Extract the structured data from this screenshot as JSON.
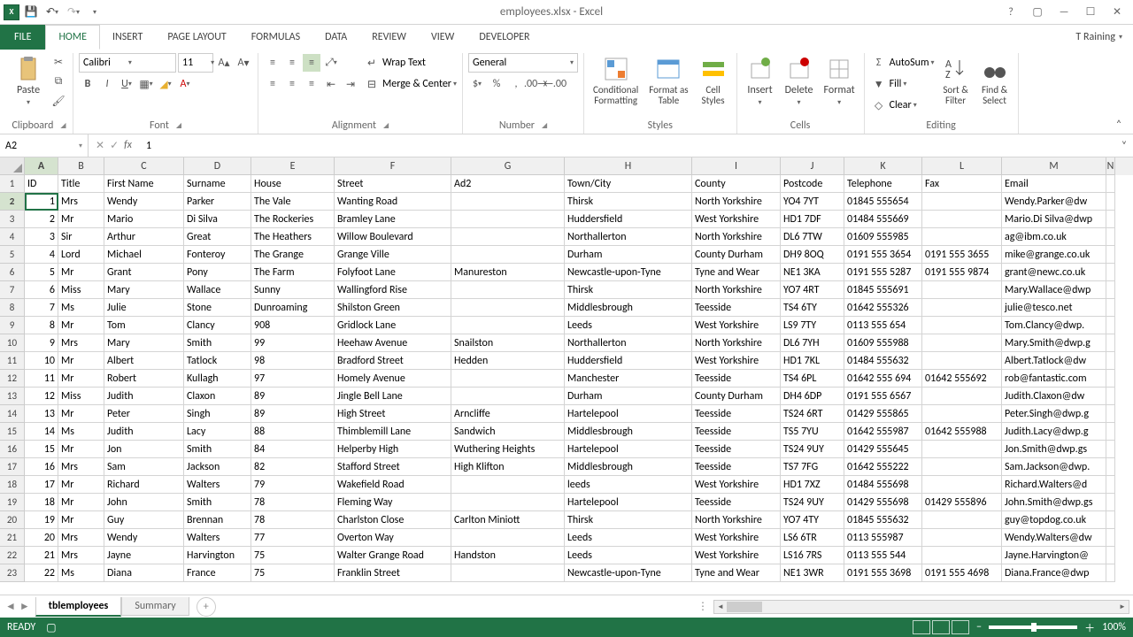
{
  "title": "employees.xlsx - Excel",
  "user": "T Raining",
  "tabs": {
    "file": "FILE",
    "home": "HOME",
    "insert": "INSERT",
    "page": "PAGE LAYOUT",
    "formulas": "FORMULAS",
    "data": "DATA",
    "review": "REVIEW",
    "view": "VIEW",
    "dev": "DEVELOPER"
  },
  "ribbon": {
    "clipboard": {
      "paste": "Paste",
      "label": "Clipboard"
    },
    "font": {
      "name": "Calibri",
      "size": "11",
      "label": "Font"
    },
    "alignment": {
      "wrap": "Wrap Text",
      "merge": "Merge & Center",
      "label": "Alignment"
    },
    "number": {
      "format": "General",
      "label": "Number"
    },
    "styles": {
      "cond": "Conditional\nFormatting",
      "fmt": "Format as\nTable",
      "cell": "Cell\nStyles",
      "label": "Styles"
    },
    "cells": {
      "insert": "Insert",
      "delete": "Delete",
      "format": "Format",
      "label": "Cells"
    },
    "editing": {
      "sum": "AutoSum",
      "fill": "Fill",
      "clear": "Clear",
      "sort": "Sort &\nFilter",
      "find": "Find &\nSelect",
      "label": "Editing"
    }
  },
  "namebox": "A2",
  "formula": "1",
  "sheets": {
    "active": "tblemployees",
    "other": "Summary"
  },
  "status": "READY",
  "zoom": "100%",
  "columns": [
    "A",
    "B",
    "C",
    "D",
    "E",
    "F",
    "G",
    "H",
    "I",
    "J",
    "K",
    "L",
    "M",
    "N"
  ],
  "headers": [
    "ID",
    "Title",
    "First Name",
    "Surname",
    "House",
    "Street",
    "Ad2",
    "Town/City",
    "County",
    "Postcode",
    "Telephone",
    "Fax",
    "Email",
    ""
  ],
  "chart_data": {
    "type": "table",
    "rows": [
      {
        "ID": 1,
        "Title": "Mrs",
        "First Name": "Wendy",
        "Surname": "Parker",
        "House": "The Vale",
        "Street": "Wanting Road",
        "Ad2": "",
        "Town/City": "Thirsk",
        "County": "North Yorkshire",
        "Postcode": "YO4 7YT",
        "Telephone": "01845 555654",
        "Fax": "",
        "Email": "Wendy.Parker@dw"
      },
      {
        "ID": 2,
        "Title": "Mr",
        "First Name": "Mario",
        "Surname": "Di Silva",
        "House": "The Rockeries",
        "Street": "Bramley Lane",
        "Ad2": "",
        "Town/City": "Huddersfield",
        "County": "West Yorkshire",
        "Postcode": "HD1 7DF",
        "Telephone": "01484 555669",
        "Fax": "",
        "Email": "Mario.Di Silva@dwp"
      },
      {
        "ID": 3,
        "Title": "Sir",
        "First Name": "Arthur",
        "Surname": "Great",
        "House": "The Heathers",
        "Street": "Willow Boulevard",
        "Ad2": "",
        "Town/City": "Northallerton",
        "County": "North Yorkshire",
        "Postcode": "DL6 7TW",
        "Telephone": "01609 555985",
        "Fax": "",
        "Email": "ag@ibm.co.uk"
      },
      {
        "ID": 4,
        "Title": "Lord",
        "First Name": "Michael",
        "Surname": "Fonteroy",
        "House": "The Grange",
        "Street": "Grange Ville",
        "Ad2": "",
        "Town/City": "Durham",
        "County": "County Durham",
        "Postcode": "DH9 8OQ",
        "Telephone": "0191 555 3654",
        "Fax": "0191 555 3655",
        "Email": "mike@grange.co.uk"
      },
      {
        "ID": 5,
        "Title": "Mr",
        "First Name": "Grant",
        "Surname": "Pony",
        "House": "The Farm",
        "Street": "Folyfoot Lane",
        "Ad2": "Manureston",
        "Town/City": "Newcastle-upon-Tyne",
        "County": "Tyne and Wear",
        "Postcode": "NE1 3KA",
        "Telephone": "0191 555 5287",
        "Fax": "0191 555 9874",
        "Email": "grant@newc.co.uk"
      },
      {
        "ID": 6,
        "Title": "Miss",
        "First Name": "Mary",
        "Surname": "Wallace",
        "House": "Sunny",
        "Street": "Wallingford Rise",
        "Ad2": "",
        "Town/City": "Thirsk",
        "County": "North Yorkshire",
        "Postcode": "YO7 4RT",
        "Telephone": "01845 555691",
        "Fax": "",
        "Email": "Mary.Wallace@dwp"
      },
      {
        "ID": 7,
        "Title": "Ms",
        "First Name": "Julie",
        "Surname": "Stone",
        "House": "Dunroaming",
        "Street": "Shilston Green",
        "Ad2": "",
        "Town/City": "Middlesbrough",
        "County": "Teesside",
        "Postcode": "TS4 6TY",
        "Telephone": "01642 555326",
        "Fax": "",
        "Email": "julie@tesco.net"
      },
      {
        "ID": 8,
        "Title": "Mr",
        "First Name": "Tom",
        "Surname": "Clancy",
        "House": "908",
        "Street": "Gridlock Lane",
        "Ad2": "",
        "Town/City": "Leeds",
        "County": "West Yorkshire",
        "Postcode": "LS9 7TY",
        "Telephone": "0113 555 654",
        "Fax": "",
        "Email": "Tom.Clancy@dwp."
      },
      {
        "ID": 9,
        "Title": "Mrs",
        "First Name": "Mary",
        "Surname": "Smith",
        "House": "99",
        "Street": "Heehaw Avenue",
        "Ad2": "Snailston",
        "Town/City": "Northallerton",
        "County": "North Yorkshire",
        "Postcode": "DL6 7YH",
        "Telephone": "01609 555988",
        "Fax": "",
        "Email": "Mary.Smith@dwp.g"
      },
      {
        "ID": 10,
        "Title": "Mr",
        "First Name": "Albert",
        "Surname": "Tatlock",
        "House": "98",
        "Street": "Bradford Street",
        "Ad2": "Hedden",
        "Town/City": "Huddersfield",
        "County": "West Yorkshire",
        "Postcode": "HD1 7KL",
        "Telephone": "01484 555632",
        "Fax": "",
        "Email": "Albert.Tatlock@dw"
      },
      {
        "ID": 11,
        "Title": "Mr",
        "First Name": "Robert",
        "Surname": "Kullagh",
        "House": "97",
        "Street": "Homely Avenue",
        "Ad2": "",
        "Town/City": "Manchester",
        "County": "Teesside",
        "Postcode": "TS4 6PL",
        "Telephone": "01642 555 694",
        "Fax": "01642 555692",
        "Email": "rob@fantastic.com"
      },
      {
        "ID": 12,
        "Title": "Miss",
        "First Name": "Judith",
        "Surname": "Claxon",
        "House": "89",
        "Street": "Jingle Bell Lane",
        "Ad2": "",
        "Town/City": "Durham",
        "County": "County Durham",
        "Postcode": "DH4 6DP",
        "Telephone": "0191 555 6567",
        "Fax": "",
        "Email": "Judith.Claxon@dw"
      },
      {
        "ID": 13,
        "Title": "Mr",
        "First Name": "Peter",
        "Surname": "Singh",
        "House": "89",
        "Street": "High Street",
        "Ad2": "Arncliffe",
        "Town/City": "Hartelepool",
        "County": "Teesside",
        "Postcode": "TS24 6RT",
        "Telephone": "01429 555865",
        "Fax": "",
        "Email": "Peter.Singh@dwp.g"
      },
      {
        "ID": 14,
        "Title": "Ms",
        "First Name": "Judith",
        "Surname": "Lacy",
        "House": "88",
        "Street": "Thimblemill Lane",
        "Ad2": "Sandwich",
        "Town/City": "Middlesbrough",
        "County": "Teesside",
        "Postcode": "TS5 7YU",
        "Telephone": "01642 555987",
        "Fax": "01642 555988",
        "Email": "Judith.Lacy@dwp.g"
      },
      {
        "ID": 15,
        "Title": "Mr",
        "First Name": "Jon",
        "Surname": "Smith",
        "House": "84",
        "Street": "Helperby High",
        "Ad2": "Wuthering Heights",
        "Town/City": "Hartelepool",
        "County": "Teesside",
        "Postcode": "TS24 9UY",
        "Telephone": "01429 555645",
        "Fax": "",
        "Email": "Jon.Smith@dwp.gs"
      },
      {
        "ID": 16,
        "Title": "Mrs",
        "First Name": "Sam",
        "Surname": "Jackson",
        "House": "82",
        "Street": "Stafford Street",
        "Ad2": "High Klifton",
        "Town/City": "Middlesbrough",
        "County": "Teesside",
        "Postcode": "TS7 7FG",
        "Telephone": "01642 555222",
        "Fax": "",
        "Email": "Sam.Jackson@dwp."
      },
      {
        "ID": 17,
        "Title": "Mr",
        "First Name": "Richard",
        "Surname": "Walters",
        "House": "79",
        "Street": "Wakefield Road",
        "Ad2": "",
        "Town/City": "leeds",
        "County": "West Yorkshire",
        "Postcode": "HD1 7XZ",
        "Telephone": "01484 555698",
        "Fax": "",
        "Email": "Richard.Walters@d"
      },
      {
        "ID": 18,
        "Title": "Mr",
        "First Name": "John",
        "Surname": "Smith",
        "House": "78",
        "Street": "Fleming Way",
        "Ad2": "",
        "Town/City": "Hartelepool",
        "County": "Teesside",
        "Postcode": "TS24 9UY",
        "Telephone": "01429 555698",
        "Fax": "01429 555896",
        "Email": "John.Smith@dwp.gs"
      },
      {
        "ID": 19,
        "Title": "Mr",
        "First Name": "Guy",
        "Surname": "Brennan",
        "House": "78",
        "Street": "Charlston Close",
        "Ad2": "Carlton Miniott",
        "Town/City": "Thirsk",
        "County": "North Yorkshire",
        "Postcode": "YO7 4TY",
        "Telephone": "01845 555632",
        "Fax": "",
        "Email": "guy@topdog.co.uk"
      },
      {
        "ID": 20,
        "Title": "Mrs",
        "First Name": "Wendy",
        "Surname": "Walters",
        "House": "77",
        "Street": "Overton Way",
        "Ad2": "",
        "Town/City": "Leeds",
        "County": "West Yorkshire",
        "Postcode": "LS6 6TR",
        "Telephone": "0113 555987",
        "Fax": "",
        "Email": "Wendy.Walters@dw"
      },
      {
        "ID": 21,
        "Title": "Mrs",
        "First Name": "Jayne",
        "Surname": "Harvington",
        "House": "75",
        "Street": "Walter Grange Road",
        "Ad2": "Handston",
        "Town/City": "Leeds",
        "County": "West Yorkshire",
        "Postcode": "LS16 7RS",
        "Telephone": "0113 555 544",
        "Fax": "",
        "Email": "Jayne.Harvington@"
      },
      {
        "ID": 22,
        "Title": "Ms",
        "First Name": "Diana",
        "Surname": "France",
        "House": "75",
        "Street": "Franklin Street",
        "Ad2": "",
        "Town/City": "Newcastle-upon-Tyne",
        "County": "Tyne and Wear",
        "Postcode": "NE1 3WR",
        "Telephone": "0191 555 3698",
        "Fax": "0191 555 4698",
        "Email": "Diana.France@dwp"
      }
    ]
  }
}
